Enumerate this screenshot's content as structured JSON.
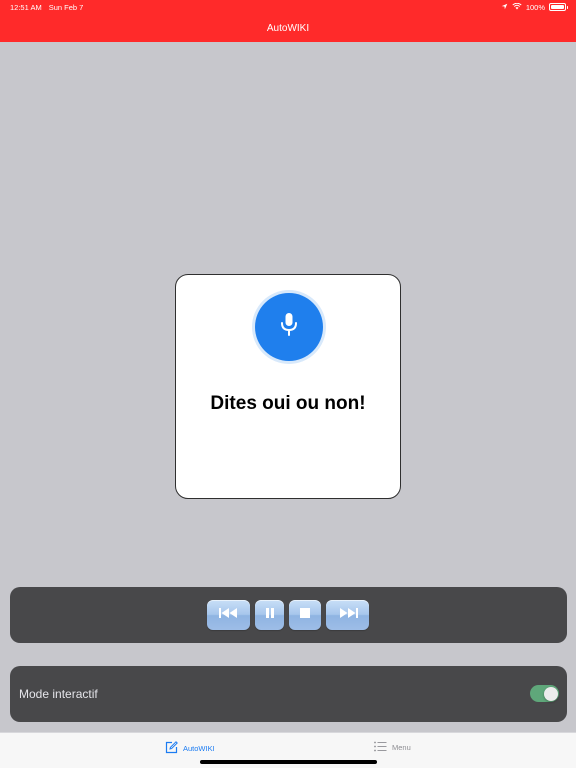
{
  "status_bar": {
    "time": "12:51 AM",
    "date": "Sun Feb 7",
    "battery_percent": "100%",
    "battery_level": 1.0,
    "icons": [
      "location-icon",
      "wifi-icon",
      "battery-icon"
    ]
  },
  "nav": {
    "title": "AutoWIKI",
    "background_color": "#ff2a2a"
  },
  "dialog": {
    "icon": "microphone-icon",
    "message": "Dites oui ou non!",
    "icon_color": "#1f7fed"
  },
  "player": {
    "controls": [
      {
        "name": "previous",
        "icon": "skip-back-icon"
      },
      {
        "name": "pause",
        "icon": "pause-icon"
      },
      {
        "name": "stop",
        "icon": "stop-icon"
      },
      {
        "name": "next",
        "icon": "skip-forward-icon"
      }
    ]
  },
  "mode": {
    "label": "Mode interactif",
    "enabled": true,
    "toggle_color": "#5fa77a"
  },
  "tab_bar": {
    "active": "AutoWIKI",
    "accent_color": "#1c7cf2",
    "tabs": [
      {
        "label": "AutoWIKI",
        "icon": "compose-icon"
      },
      {
        "label": "Menu",
        "icon": "list-icon"
      }
    ]
  }
}
